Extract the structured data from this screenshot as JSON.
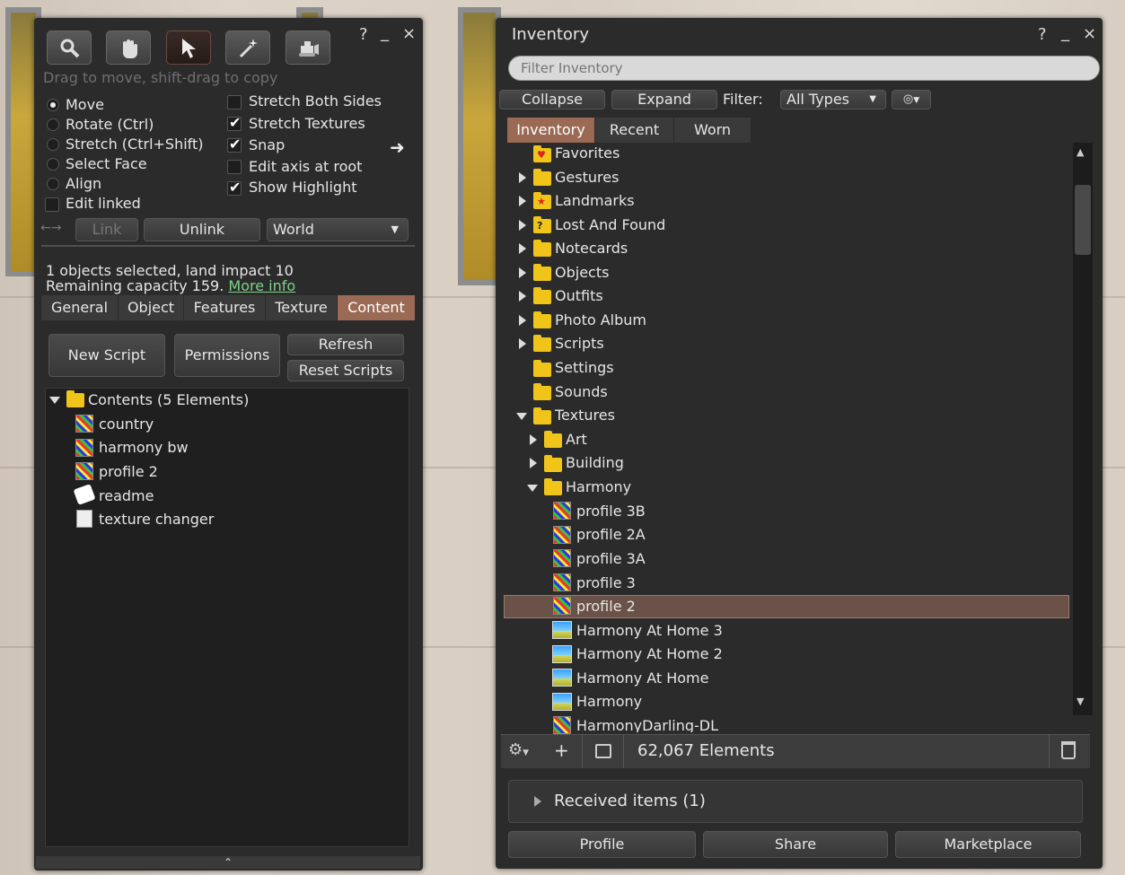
{
  "left_panel": {
    "help": "?",
    "minimize": "_",
    "close": "×",
    "hint": "Drag to move, shift-drag to copy",
    "radios": [
      {
        "label": "Move",
        "checked": true
      },
      {
        "label": "Rotate (Ctrl)",
        "checked": false
      },
      {
        "label": "Stretch (Ctrl+Shift)",
        "checked": false
      },
      {
        "label": "Select Face",
        "checked": false
      },
      {
        "label": "Align",
        "checked": false
      }
    ],
    "edit_linked": "Edit linked",
    "checks": [
      {
        "label": "Stretch Both Sides",
        "checked": false
      },
      {
        "label": "Stretch Textures",
        "checked": true
      },
      {
        "label": "Snap",
        "checked": true
      },
      {
        "label": "Edit axis at root",
        "checked": false
      },
      {
        "label": "Show Highlight",
        "checked": true
      }
    ],
    "link": "Link",
    "unlink": "Unlink",
    "ruler": "World",
    "selection_info": "1 objects selected, land impact 10",
    "capacity": "Remaining capacity 159.",
    "more_info": "More info",
    "tabs": [
      "General",
      "Object",
      "Features",
      "Texture",
      "Content"
    ],
    "new_script": "New Script",
    "permissions": "Permissions",
    "refresh": "Refresh",
    "reset_scripts": "Reset Scripts",
    "contents_folder": "Contents (5 Elements)",
    "contents": [
      "country",
      "harmony bw",
      "profile 2",
      "readme",
      "texture changer"
    ]
  },
  "inventory": {
    "title": "Inventory",
    "help": "?",
    "minimize": "_",
    "close": "×",
    "filter_placeholder": "Filter Inventory",
    "collapse": "Collapse",
    "expand": "Expand",
    "filter_label": "Filter:",
    "filter_value": "All Types",
    "tabs": [
      "Inventory",
      "Recent",
      "Worn"
    ],
    "folders": [
      "Favorites",
      "Gestures",
      "Landmarks",
      "Lost And Found",
      "Notecards",
      "Objects",
      "Outfits",
      "Photo Album",
      "Scripts",
      "Settings",
      "Sounds",
      "Textures"
    ],
    "subfolders": [
      "Art",
      "Building",
      "Harmony"
    ],
    "items": [
      "profile 3B",
      "profile 2A",
      "profile 3A",
      "profile 3",
      "profile 2",
      "Harmony At Home 3",
      "Harmony At Home 2",
      "Harmony At Home",
      "Harmony",
      "HarmonyDarling-DL"
    ],
    "plus": "+",
    "count": "62,067 Elements",
    "received": "Received items (1)",
    "profile": "Profile",
    "share": "Share",
    "marketplace": "Marketplace"
  }
}
